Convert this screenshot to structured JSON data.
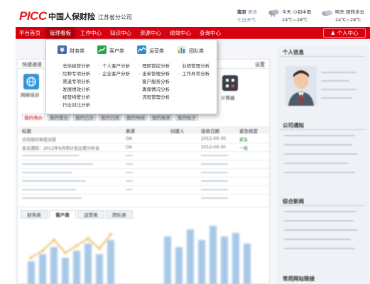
{
  "brand": {
    "logo": "PICC",
    "name": "中国人保财险",
    "branch": "江苏省分公司"
  },
  "weather": {
    "city": "南京",
    "change": "更改",
    "link": "七日天气",
    "today_label": "今天",
    "today_desc": "小到中雨",
    "today_temp": "24℃~28℃",
    "tomorrow_label": "明天",
    "tomorrow_desc": "阴转多云",
    "tomorrow_temp": "24℃~28℃"
  },
  "nav": {
    "items": [
      "平台首页",
      "管理看板",
      "工作中心",
      "知识中心",
      "资源中心",
      "绩效中心",
      "查询中心"
    ],
    "personal": "个人中心"
  },
  "dropdown": {
    "columns": [
      {
        "title": "财务类",
        "items": [
          "总体经营分析",
          "险种专项分析",
          "渠道专项分析",
          "发展绩效分析",
          "经营特警分析",
          "行业对比分析"
        ]
      },
      {
        "title": "客户类",
        "items": [
          "个人客户分析",
          "企业客户分析"
        ]
      },
      {
        "title": "运营类",
        "items": [
          "理赔管控分析",
          "出单管理分析",
          "客户服务分析",
          "再保情况分析",
          "流程管理分析"
        ]
      },
      {
        "title": "团队类",
        "items": [
          "业绩管理分析",
          "工作异常分析"
        ]
      }
    ]
  },
  "quick": {
    "title": "快捷通道",
    "settings": "设置",
    "left_tile": "网络培训",
    "right_tile": "计算器"
  },
  "tasks": {
    "tabs": [
      "我的待办",
      "我的督办",
      "我的已办",
      "我的已阅",
      "我的待阅",
      "我的报表",
      "我的帖子"
    ],
    "headers": [
      "标题",
      "来源",
      "创建人",
      "接收日期",
      "紧急程度"
    ],
    "rows": [
      {
        "title": "合同用印审批流程",
        "source": "OA",
        "date": "2012-09-30",
        "level": "紧急"
      },
      {
        "title": "会议通知：2012年9月用计划运营分析会",
        "source": "OA",
        "date": "2012-09-30",
        "level": "一般"
      }
    ]
  },
  "chart_tabs": [
    "财务类",
    "客户类",
    "运营类",
    "团队类"
  ],
  "sidebar": {
    "profile": "个人信息",
    "notice": "公司通知",
    "news": "综合新闻",
    "links": "常用网站链接"
  },
  "colors": {
    "brand_red": "#d7000f",
    "nav_active": "#b0000a",
    "tile_blue": "#2f95d8",
    "tile_dark": "#3a3f47"
  }
}
